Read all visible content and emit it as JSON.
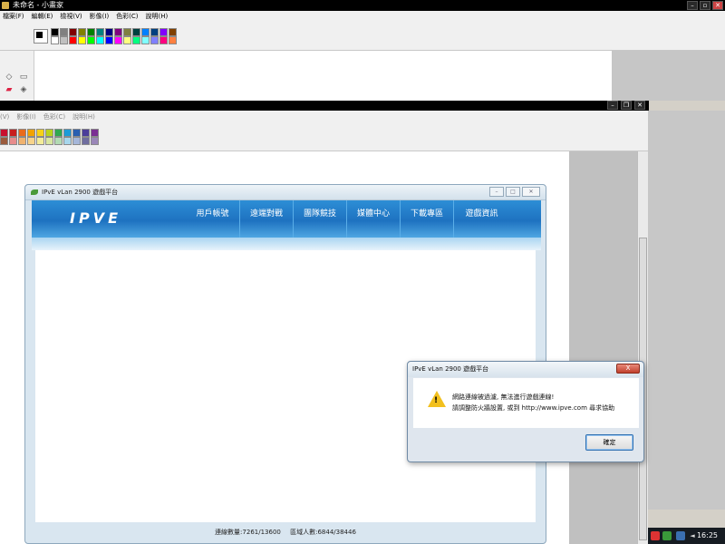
{
  "paint_back": {
    "title": "未命名 - 小畫家",
    "menu": [
      "檔案(F)",
      "編輯(E)",
      "檢視(V)",
      "影像(I)",
      "色彩(C)",
      "說明(H)"
    ]
  },
  "paint_front": {
    "menu": [
      "(V)",
      "影像(I)",
      "色彩(C)",
      "說明(H)"
    ]
  },
  "colors": {
    "palette_row1": [
      "#000000",
      "#808080",
      "#800000",
      "#808000",
      "#008000",
      "#008080",
      "#000080",
      "#800080",
      "#808040",
      "#004040",
      "#0080ff",
      "#004080",
      "#8000ff",
      "#804000"
    ],
    "palette_row2": [
      "#ffffff",
      "#c0c0c0",
      "#ff0000",
      "#ffff00",
      "#00ff00",
      "#00ffff",
      "#0000ff",
      "#ff00ff",
      "#ffff80",
      "#00ff80",
      "#80ffff",
      "#8080ff",
      "#ff0080",
      "#ff8040"
    ],
    "palette2_row1": [
      "#c8102e",
      "#c81e1e",
      "#ea6a1c",
      "#f2a200",
      "#f7d117",
      "#b9d31c",
      "#2fa84f",
      "#1d9bd7",
      "#2a5fb0",
      "#4b3d9a",
      "#7b2f93"
    ],
    "palette2_row2": [
      "#9a5a3c",
      "#e78c8c",
      "#f0b26f",
      "#f7d38b",
      "#f3ec99",
      "#d8e6a0",
      "#b2dab3",
      "#a7d6ec",
      "#a5b6d9",
      "#6f6d9f",
      "#9a86b8"
    ]
  },
  "ipve": {
    "title": "IPvE vLan 2900 遊戲平台",
    "brand": "IPVE",
    "nav": [
      "用戶帳號",
      "遠端對戰",
      "團隊競技",
      "媒體中心",
      "下載專區",
      "遊戲資訊"
    ],
    "status_connections": "連線數量:7261/13600",
    "status_regional": "區域人數:6844/38446"
  },
  "dialog": {
    "title": "IPvE vLan 2900 遊戲平台",
    "close_label": "X",
    "line1": "網路連線被過濾, 無法進行遊戲連線!",
    "line2": "請調整防火牆設置, 或到 http://www.ipve.com 尋求協助",
    "ok_label": "確定"
  },
  "tray": {
    "time": "16:25"
  }
}
